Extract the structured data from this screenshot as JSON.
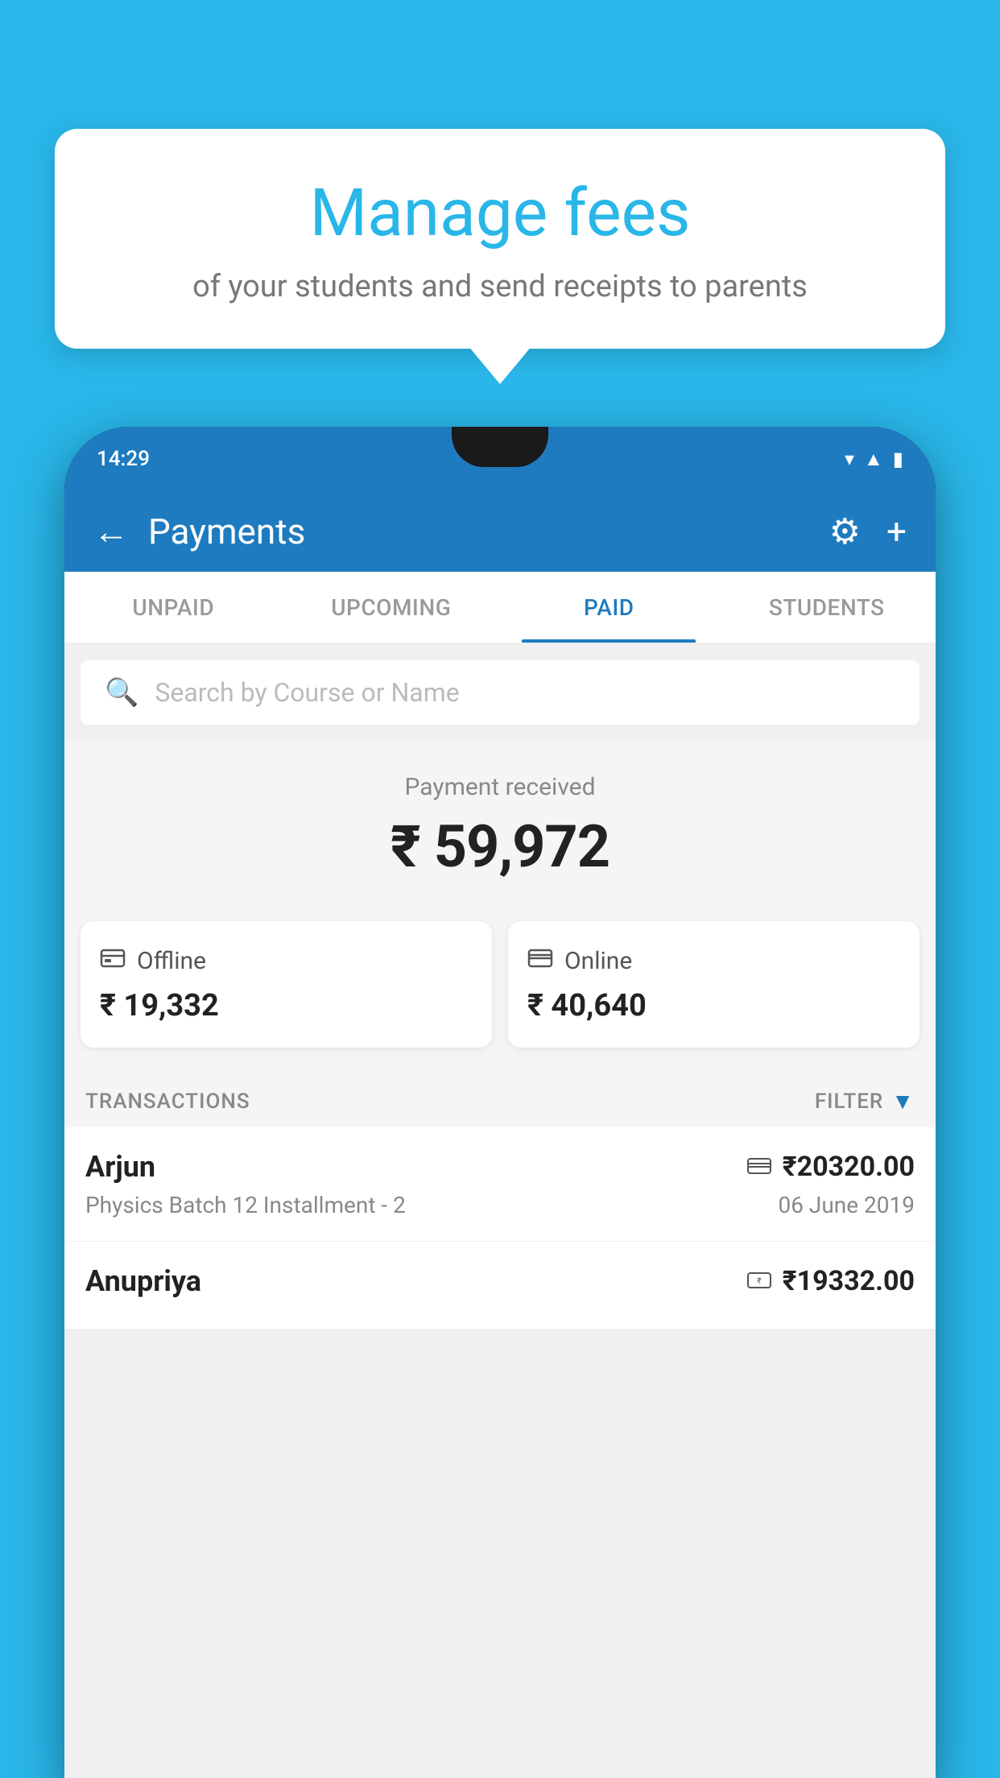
{
  "background_color": "#29b6e8",
  "tooltip": {
    "title": "Manage fees",
    "subtitle": "of your students and send receipts to parents"
  },
  "phone": {
    "status_bar": {
      "time": "14:29"
    },
    "header": {
      "title": "Payments",
      "back_label": "←",
      "gear_label": "⚙",
      "plus_label": "+"
    },
    "tabs": [
      {
        "label": "UNPAID",
        "active": false
      },
      {
        "label": "UPCOMING",
        "active": false
      },
      {
        "label": "PAID",
        "active": true
      },
      {
        "label": "STUDENTS",
        "active": false
      }
    ],
    "search": {
      "placeholder": "Search by Course or Name"
    },
    "payment_summary": {
      "label": "Payment received",
      "amount": "₹ 59,972"
    },
    "payment_cards": [
      {
        "label": "Offline",
        "amount": "₹ 19,332",
        "icon": "💳"
      },
      {
        "label": "Online",
        "amount": "₹ 40,640",
        "icon": "💳"
      }
    ],
    "transactions_section": {
      "label": "TRANSACTIONS",
      "filter_label": "FILTER"
    },
    "transactions": [
      {
        "name": "Arjun",
        "course": "Physics Batch 12 Installment - 2",
        "amount": "₹20320.00",
        "date": "06 June 2019",
        "icon": "💳"
      },
      {
        "name": "Anupriya",
        "course": "",
        "amount": "₹19332.00",
        "date": "",
        "icon": "💵"
      }
    ]
  }
}
